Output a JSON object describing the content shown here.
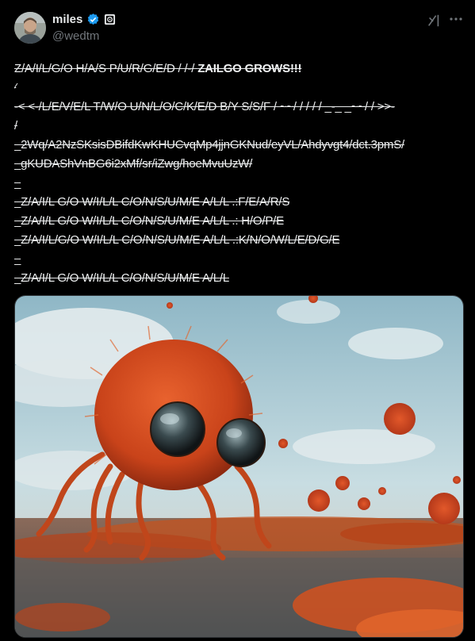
{
  "author": {
    "display_name": "miles",
    "handle": "@wedtm"
  },
  "tweet": {
    "lines": [
      {
        "text": "Z/A/I/L/G/O H/A/S P/U/R/G/E/D / /-/ ",
        "bold_suffix": "ZAILGO GROWS!!!"
      },
      {
        "text": "⁄"
      },
      {
        "text": "-< <-/L/E/V/E/L T/W/O U/N/L/O/C/K/E/D B/Y S/S/F / ~~/ / / / / _-_ _~~/ / >>-"
      },
      {
        "text": "/"
      },
      {
        "text": "_2Wq/A2NzSKsisDBifdKwKHUCvqMp4jjnGKNud/eyVL/Ahdyvgt4/dct.3pmS/"
      },
      {
        "text": "_gKUDAShVnBG6i2xMf/sr/iZwg/hoeMvuUzW/"
      },
      {
        "text": "_"
      },
      {
        "text": "_Z/A/I/L G/O W/I/L/L C/O/N/S/U/M/E A/L/L .:F/E/A/R/S"
      },
      {
        "text": "_Z/A/I/L G/O W/I/L/L C/O/N/S/U/M/E A/L/L .: H/O/P/E"
      },
      {
        "text": "_Z/A/I/L/G/O W/I/L/L C/O/N/S/U/M/E A/L/L .:K/N/O/W/L/E/D/G/E"
      },
      {
        "text": "_"
      },
      {
        "text": "_Z/A/I/L G/O W/I/L/L C/O/N/S/U/M/E A/L/L"
      }
    ]
  },
  "icons": {
    "verified": "verified-badge-icon",
    "affiliation": "affiliation-badge-icon",
    "grok": "grok-icon",
    "more": "more-icon"
  },
  "colors": {
    "background": "#000000",
    "text": "#e7e9ea",
    "muted": "#71767b",
    "verified": "#1d9bf0",
    "creature": "#d4451c"
  }
}
